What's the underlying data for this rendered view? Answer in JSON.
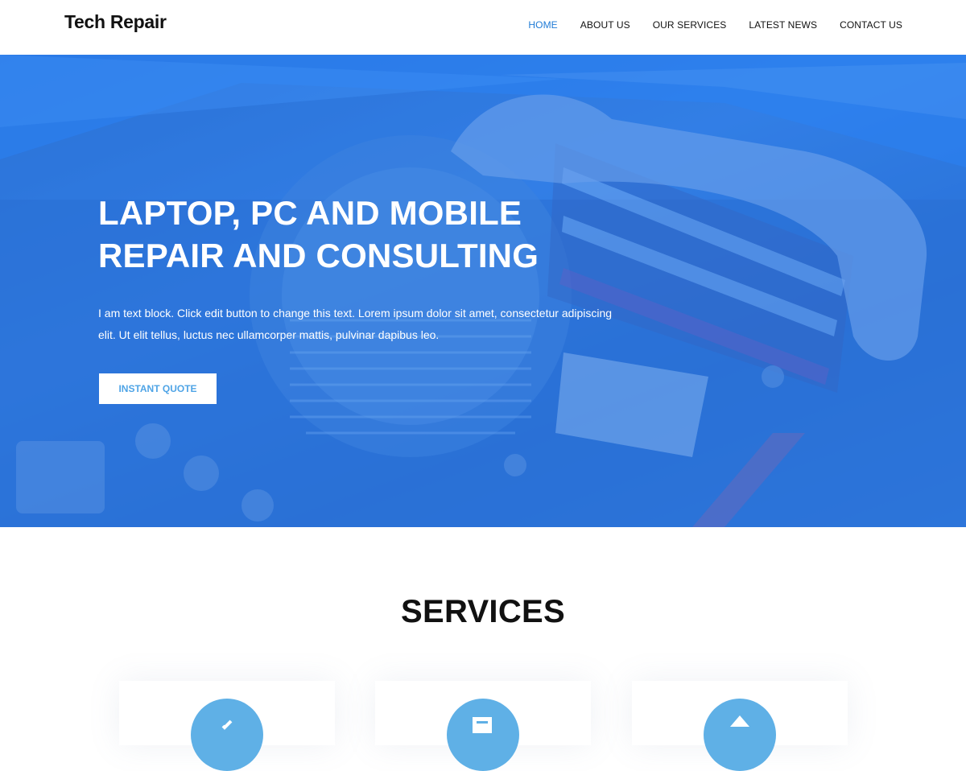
{
  "header": {
    "logo": "Tech Repair",
    "nav": [
      {
        "label": "HOME",
        "active": true
      },
      {
        "label": "ABOUT US",
        "active": false
      },
      {
        "label": "OUR SERVICES",
        "active": false
      },
      {
        "label": "LATEST NEWS",
        "active": false
      },
      {
        "label": "CONTACT US",
        "active": false
      }
    ]
  },
  "hero": {
    "title": "LAPTOP, PC AND MOBILE REPAIR AND CONSULTING",
    "text": "I am text block. Click edit button to change this text. Lorem ipsum dolor sit amet, consectetur adipiscing elit. Ut elit tellus, luctus nec ullamcorper mattis, pulvinar dapibus leo.",
    "button": "INSTANT QUOTE",
    "overlay_color": "#2378f0",
    "background_image": "motherboard-photo"
  },
  "services": {
    "title": "SERVICES",
    "cards": [
      {
        "icon": "circle-icon-1"
      },
      {
        "icon": "document-icon"
      },
      {
        "icon": "chevron-up-icon"
      }
    ],
    "icon_color": "#5fb0e6"
  },
  "colors": {
    "accent": "#1f7bd6",
    "button_text": "#4fa4e6"
  }
}
